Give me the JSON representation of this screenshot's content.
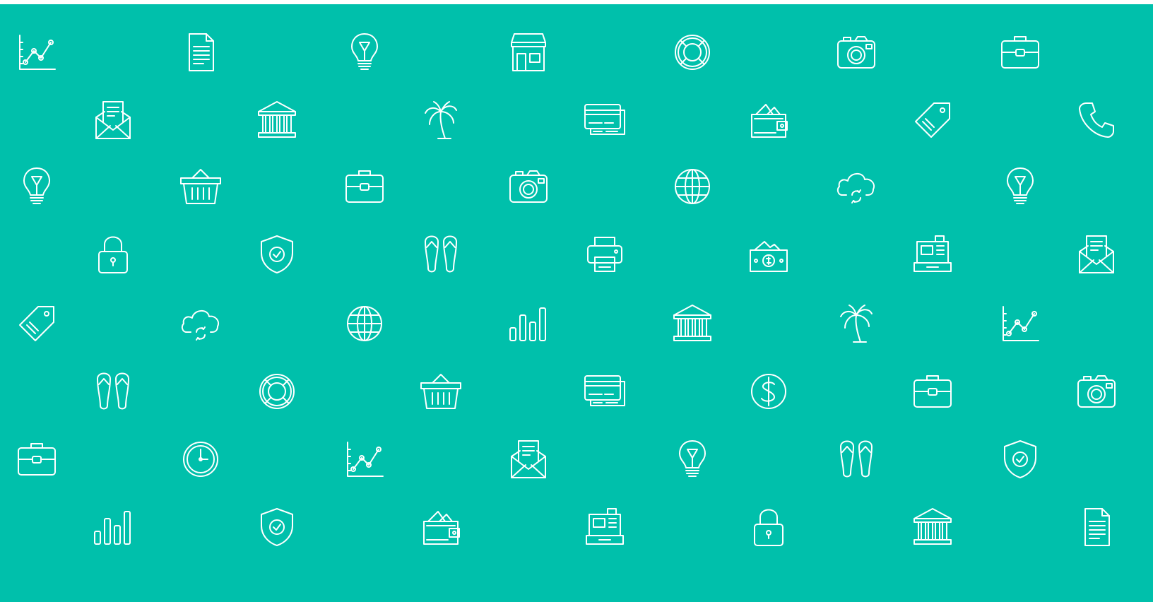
{
  "background_color": "#00c0ab",
  "icon_color": "#ffffff",
  "rows": [
    {
      "row": "1",
      "icons": [
        "line-chart-icon",
        "document-icon",
        "lightbulb-icon",
        "storefront-icon",
        "lifebuoy-icon",
        "camera-icon",
        "briefcase-icon"
      ]
    },
    {
      "row": "2",
      "icons": [
        "envelope-letter-icon",
        "bank-icon",
        "palm-tree-icon",
        "credit-cards-icon",
        "wallet-icon",
        "price-tag-icon",
        "phone-icon"
      ]
    },
    {
      "row": "3",
      "icons": [
        "lightbulb-icon",
        "basket-icon",
        "briefcase-icon",
        "camera-icon",
        "globe-icon",
        "cloud-sync-icon",
        "lightbulb-icon"
      ]
    },
    {
      "row": "4",
      "icons": [
        "padlock-icon",
        "shield-check-icon",
        "flip-flops-icon",
        "printer-icon",
        "cash-icon",
        "cash-register-icon",
        "envelope-letter-icon"
      ]
    },
    {
      "row": "5",
      "icons": [
        "price-tag-icon",
        "cloud-sync-icon",
        "globe-icon",
        "bar-chart-icon",
        "bank-icon",
        "palm-tree-icon",
        "line-chart-icon"
      ]
    },
    {
      "row": "6",
      "icons": [
        "flip-flops-icon",
        "lifebuoy-icon",
        "basket-icon",
        "credit-cards-icon",
        "dollar-coin-icon",
        "briefcase-icon",
        "camera-icon"
      ]
    },
    {
      "row": "7",
      "icons": [
        "briefcase-icon",
        "clock-icon",
        "line-chart-icon",
        "envelope-letter-icon",
        "lightbulb-icon",
        "flip-flops-icon",
        "shield-check-icon"
      ]
    },
    {
      "row": "8",
      "icons": [
        "bar-chart-icon",
        "shield-check-icon",
        "wallet-icon",
        "cash-register-icon",
        "padlock-icon",
        "bank-icon",
        "document-icon"
      ]
    }
  ]
}
